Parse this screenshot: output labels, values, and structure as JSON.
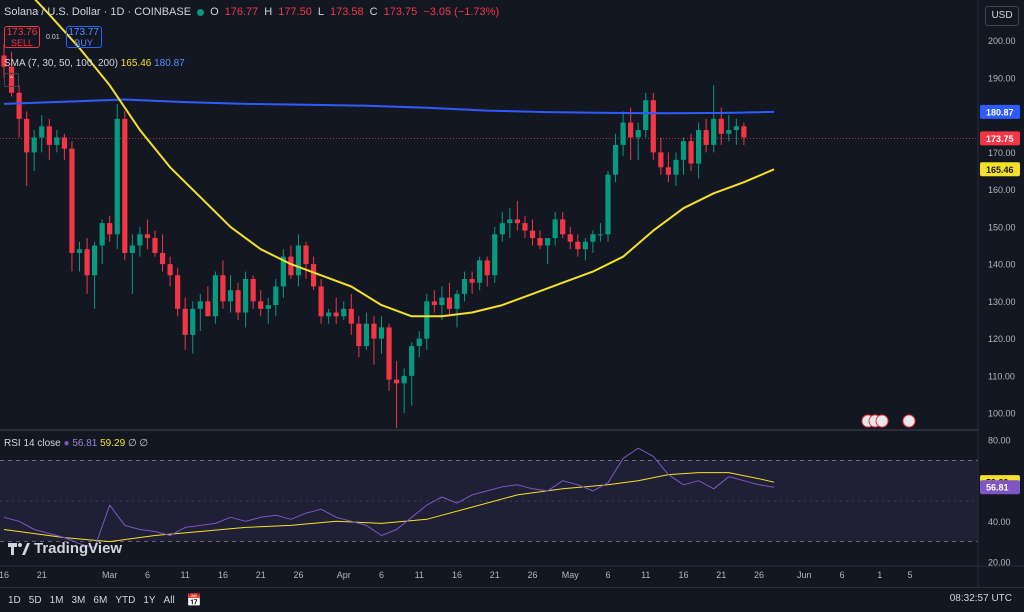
{
  "header": {
    "symbol": "Solana / U.S. Dollar · 1D · COINBASE",
    "o_label": "O",
    "o": "176.77",
    "h_label": "H",
    "h": "177.50",
    "l_label": "L",
    "l": "173.58",
    "c_label": "C",
    "c": "173.75",
    "change": "−3.05 (−1.73%)"
  },
  "trade": {
    "sell_price": "173.76",
    "sell_label": "SELL",
    "spread": "0.01",
    "buy_price": "173.77",
    "buy_label": "BUY"
  },
  "sma_legend": {
    "text": "SMA (7, 30, 50, 100, 200)",
    "v1": "165.46",
    "v2": "180.87"
  },
  "rsi_legend": {
    "text": "RSI 14 close",
    "v1": "56.81",
    "v2": "59.29",
    "extra": "∅ ∅"
  },
  "currency": "USD",
  "brand": "TradingView",
  "ranges": [
    "1D",
    "5D",
    "1M",
    "3M",
    "6M",
    "YTD",
    "1Y",
    "All"
  ],
  "clock": "08:32:57 UTC",
  "colors": {
    "up": "#089981",
    "down": "#f23645",
    "sma_yellow": "#f5e12a",
    "sma_blue": "#2e5bff",
    "rsi": "#7e57c2"
  },
  "chart_data": [
    {
      "type": "candlestick",
      "y_ticks": [
        100,
        110,
        120,
        130,
        140,
        150,
        160,
        170,
        180,
        190,
        200
      ],
      "ylim": [
        96,
        205
      ],
      "x_ticks": [
        {
          "label": "16",
          "i": 0
        },
        {
          "label": "21",
          "i": 5
        },
        {
          "label": "Mar",
          "i": 14
        },
        {
          "label": "6",
          "i": 19
        },
        {
          "label": "11",
          "i": 24
        },
        {
          "label": "16",
          "i": 29
        },
        {
          "label": "21",
          "i": 34
        },
        {
          "label": "26",
          "i": 39
        },
        {
          "label": "Apr",
          "i": 45
        },
        {
          "label": "6",
          "i": 50
        },
        {
          "label": "11",
          "i": 55
        },
        {
          "label": "16",
          "i": 60
        },
        {
          "label": "21",
          "i": 65
        },
        {
          "label": "26",
          "i": 70
        },
        {
          "label": "May",
          "i": 75
        },
        {
          "label": "6",
          "i": 80
        },
        {
          "label": "11",
          "i": 85
        },
        {
          "label": "16",
          "i": 90
        },
        {
          "label": "21",
          "i": 95
        },
        {
          "label": "26",
          "i": 100
        },
        {
          "label": "Jun",
          "i": 106
        },
        {
          "label": "6",
          "i": 111
        },
        {
          "label": "1",
          "i": 116
        },
        {
          "label": "5",
          "i": 120
        }
      ],
      "ohlc": [
        [
          196,
          199,
          190,
          193
        ],
        [
          193,
          197,
          185,
          186
        ],
        [
          186,
          188,
          174,
          179
        ],
        [
          179,
          181,
          161,
          170
        ],
        [
          170,
          176,
          165,
          174
        ],
        [
          174,
          180,
          170,
          177
        ],
        [
          177,
          179,
          168,
          172
        ],
        [
          172,
          176,
          170,
          174
        ],
        [
          174,
          175,
          168,
          171
        ],
        [
          171,
          173,
          138,
          143
        ],
        [
          143,
          146,
          138,
          144
        ],
        [
          144,
          147,
          132,
          137
        ],
        [
          137,
          146,
          128,
          145
        ],
        [
          145,
          152,
          140,
          151
        ],
        [
          151,
          153,
          146,
          148
        ],
        [
          148,
          183,
          144,
          179
        ],
        [
          179,
          181,
          141,
          143
        ],
        [
          143,
          148,
          132,
          145
        ],
        [
          145,
          150,
          142,
          148
        ],
        [
          148,
          152,
          144,
          147
        ],
        [
          147,
          149,
          142,
          143
        ],
        [
          143,
          148,
          138,
          140
        ],
        [
          140,
          142,
          134,
          137
        ],
        [
          137,
          139,
          126,
          128
        ],
        [
          128,
          131,
          117,
          121
        ],
        [
          121,
          130,
          116,
          128
        ],
        [
          128,
          132,
          122,
          130
        ],
        [
          130,
          134,
          126,
          126
        ],
        [
          126,
          138,
          124,
          137
        ],
        [
          137,
          141,
          128,
          130
        ],
        [
          130,
          137,
          127,
          133
        ],
        [
          133,
          135,
          125,
          127
        ],
        [
          127,
          138,
          123,
          136
        ],
        [
          136,
          137,
          128,
          130
        ],
        [
          130,
          133,
          126,
          128
        ],
        [
          128,
          131,
          124,
          129
        ],
        [
          129,
          136,
          126,
          134
        ],
        [
          134,
          144,
          131,
          142
        ],
        [
          142,
          145,
          136,
          137
        ],
        [
          137,
          148,
          134,
          145
        ],
        [
          145,
          146,
          136,
          140
        ],
        [
          140,
          142,
          133,
          134
        ],
        [
          134,
          136,
          124,
          126
        ],
        [
          126,
          128,
          124,
          127
        ],
        [
          127,
          131,
          124,
          126
        ],
        [
          126,
          130,
          125,
          128
        ],
        [
          128,
          132,
          121,
          124
        ],
        [
          124,
          126,
          115,
          118
        ],
        [
          118,
          127,
          117,
          124
        ],
        [
          124,
          126,
          113,
          120
        ],
        [
          120,
          126,
          116,
          123
        ],
        [
          123,
          124,
          106,
          109
        ],
        [
          109,
          114,
          96,
          108
        ],
        [
          108,
          112,
          100,
          110
        ],
        [
          110,
          119,
          102,
          118
        ],
        [
          118,
          122,
          115,
          120
        ],
        [
          120,
          132,
          117,
          130
        ],
        [
          130,
          133,
          127,
          129
        ],
        [
          129,
          134,
          125,
          131
        ],
        [
          131,
          135,
          126,
          128
        ],
        [
          128,
          133,
          123,
          132
        ],
        [
          132,
          138,
          130,
          136
        ],
        [
          136,
          138,
          132,
          135
        ],
        [
          135,
          142,
          133,
          141
        ],
        [
          141,
          142,
          134,
          137
        ],
        [
          137,
          150,
          135,
          148
        ],
        [
          148,
          154,
          146,
          151
        ],
        [
          151,
          155,
          147,
          152
        ],
        [
          152,
          157,
          149,
          151
        ],
        [
          151,
          153,
          147,
          149
        ],
        [
          149,
          152,
          145,
          147
        ],
        [
          147,
          149,
          144,
          145
        ],
        [
          145,
          147,
          140,
          147
        ],
        [
          147,
          154,
          145,
          152
        ],
        [
          152,
          154,
          147,
          148
        ],
        [
          148,
          150,
          144,
          146
        ],
        [
          146,
          148,
          142,
          144
        ],
        [
          144,
          147,
          141,
          146
        ],
        [
          146,
          149,
          143,
          148
        ],
        [
          148,
          151,
          146,
          148
        ],
        [
          148,
          165,
          146,
          164
        ],
        [
          164,
          175,
          162,
          172
        ],
        [
          172,
          181,
          169,
          178
        ],
        [
          178,
          182,
          168,
          174
        ],
        [
          174,
          178,
          168,
          176
        ],
        [
          176,
          186,
          174,
          184
        ],
        [
          184,
          186,
          168,
          170
        ],
        [
          170,
          174,
          164,
          166
        ],
        [
          166,
          170,
          162,
          164
        ],
        [
          164,
          170,
          161,
          168
        ],
        [
          168,
          174,
          164,
          173
        ],
        [
          173,
          175,
          165,
          167
        ],
        [
          167,
          178,
          163,
          176
        ],
        [
          176,
          179,
          170,
          172
        ],
        [
          172,
          188,
          170,
          179
        ],
        [
          179,
          182,
          172,
          175
        ],
        [
          175,
          180,
          173,
          176
        ],
        [
          176,
          179,
          172,
          177
        ],
        [
          177,
          178,
          172,
          174
        ]
      ],
      "sma_fast": [
        [
          0,
          220
        ],
        [
          6,
          207
        ],
        [
          10,
          198
        ],
        [
          14,
          188
        ],
        [
          18,
          176
        ],
        [
          22,
          166
        ],
        [
          26,
          158
        ],
        [
          30,
          150
        ],
        [
          34,
          144
        ],
        [
          38,
          140
        ],
        [
          42,
          137
        ],
        [
          46,
          134
        ],
        [
          50,
          129
        ],
        [
          54,
          126
        ],
        [
          58,
          126
        ],
        [
          62,
          127
        ],
        [
          66,
          129
        ],
        [
          70,
          132
        ],
        [
          74,
          135
        ],
        [
          78,
          138
        ],
        [
          82,
          142
        ],
        [
          86,
          149
        ],
        [
          90,
          155
        ],
        [
          94,
          159
        ],
        [
          98,
          162
        ],
        [
          102,
          165.46
        ]
      ],
      "sma_slow": [
        [
          0,
          183
        ],
        [
          8,
          183.6
        ],
        [
          16,
          184.2
        ],
        [
          24,
          183.5
        ],
        [
          32,
          183
        ],
        [
          40,
          182.8
        ],
        [
          48,
          182.5
        ],
        [
          56,
          182
        ],
        [
          64,
          181.2
        ],
        [
          72,
          180.8
        ],
        [
          80,
          180.6
        ],
        [
          88,
          180.5
        ],
        [
          96,
          180.6
        ],
        [
          102,
          180.87
        ]
      ],
      "last_price": 173.75,
      "sma_fast_last": 165.46,
      "sma_slow_last": 180.87
    },
    {
      "type": "line",
      "name": "RSI 14 close",
      "y_ticks": [
        20,
        40,
        60,
        80
      ],
      "ylim": [
        18,
        84
      ],
      "band": [
        30,
        70
      ],
      "rsi": [
        [
          0,
          42
        ],
        [
          2,
          40
        ],
        [
          4,
          36
        ],
        [
          6,
          34
        ],
        [
          8,
          32
        ],
        [
          10,
          29
        ],
        [
          12,
          27
        ],
        [
          14,
          48
        ],
        [
          16,
          38
        ],
        [
          18,
          36
        ],
        [
          20,
          35
        ],
        [
          22,
          33
        ],
        [
          24,
          37
        ],
        [
          26,
          38
        ],
        [
          28,
          39
        ],
        [
          30,
          42
        ],
        [
          32,
          40
        ],
        [
          34,
          42
        ],
        [
          36,
          43
        ],
        [
          38,
          41
        ],
        [
          40,
          44
        ],
        [
          42,
          46
        ],
        [
          44,
          42
        ],
        [
          46,
          40
        ],
        [
          48,
          38
        ],
        [
          50,
          33
        ],
        [
          52,
          36
        ],
        [
          54,
          42
        ],
        [
          56,
          48
        ],
        [
          58,
          52
        ],
        [
          60,
          49
        ],
        [
          62,
          53
        ],
        [
          64,
          55
        ],
        [
          66,
          57
        ],
        [
          68,
          58
        ],
        [
          70,
          56
        ],
        [
          72,
          55
        ],
        [
          74,
          60
        ],
        [
          76,
          58
        ],
        [
          78,
          55
        ],
        [
          80,
          59
        ],
        [
          82,
          71
        ],
        [
          84,
          76
        ],
        [
          86,
          72
        ],
        [
          88,
          63
        ],
        [
          90,
          58
        ],
        [
          92,
          60
        ],
        [
          94,
          56
        ],
        [
          96,
          62
        ],
        [
          98,
          60
        ],
        [
          100,
          58
        ],
        [
          102,
          56.81
        ]
      ],
      "rsi_ma": [
        [
          0,
          36
        ],
        [
          8,
          32
        ],
        [
          14,
          30
        ],
        [
          20,
          33
        ],
        [
          26,
          35
        ],
        [
          32,
          37
        ],
        [
          38,
          38
        ],
        [
          44,
          40
        ],
        [
          50,
          39
        ],
        [
          56,
          41
        ],
        [
          62,
          47
        ],
        [
          68,
          53
        ],
        [
          74,
          56
        ],
        [
          80,
          58
        ],
        [
          84,
          60
        ],
        [
          88,
          63
        ],
        [
          92,
          64
        ],
        [
          96,
          64
        ],
        [
          100,
          61
        ],
        [
          102,
          59.29
        ]
      ],
      "last_rsi": 56.81,
      "last_ma": 59.29
    }
  ]
}
